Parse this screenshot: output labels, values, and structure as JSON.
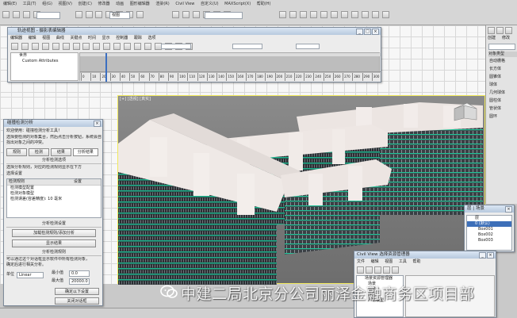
{
  "toolbar": {
    "view_dropdown": "视图",
    "selection_set_field": "",
    "main_menu": [
      "编辑(E)",
      "工具(T)",
      "组(G)",
      "视图(V)",
      "创建(C)",
      "修改器",
      "动画",
      "图形编辑器",
      "渲染(R)",
      "Civil View",
      "自定义(U)",
      "MAXScript(X)",
      "帮助(H)"
    ]
  },
  "track_view": {
    "title": "轨迹视图 - 摄影表编辑器",
    "menus": [
      "编辑器",
      "编辑",
      "视图",
      "曲线",
      "关键点",
      "时间",
      "显示",
      "控制器",
      "跟踪",
      "选项"
    ],
    "tree": [
      "世界",
      "Custom Attributes"
    ],
    "ruler_ticks": [
      "0",
      "10",
      "20",
      "30",
      "40",
      "50",
      "60",
      "70",
      "80",
      "90",
      "100",
      "110",
      "120",
      "130",
      "140",
      "150",
      "160",
      "170",
      "180",
      "190",
      "200",
      "210",
      "220",
      "230",
      "240",
      "250",
      "260",
      "270",
      "280",
      "290",
      "300"
    ]
  },
  "viewport": {
    "label": "[+] [透视] [真实]"
  },
  "left_dialog": {
    "title": "碰撞检测分析",
    "intro": "欢迎使用：碰撞检测分析工具！",
    "desc1": "选择要检测的对象集合，然后点击分析按钮，系统会自动",
    "desc2": "找出对象之间的冲突。",
    "tabs": [
      "规则",
      "检测",
      "结果",
      "分析结果"
    ],
    "section_title": "分析检测选项",
    "hint": "选择分析规则，对应的检测规则显示在下方",
    "sub": "选择设置",
    "col_name": "检测规则",
    "col_status": "设置",
    "rules": [
      "检测模型配置",
      "检测对象模型",
      "检测误差(容差精度): 10 毫米"
    ],
    "section2": "分析检测设置",
    "btn_add": "加载检测规则/添加分析",
    "btn_view": "显示结果",
    "section3": "分析检测规则",
    "detail1": "可以通过这个对话框显示软件中所有检测对象，",
    "detail2": "确定后进行相关分析。",
    "unit_label": "单位",
    "unit_value": "Linear",
    "min_label": "最小值",
    "min_value": "0.0",
    "max_label": "最大值",
    "max_value": "20000.0",
    "btn_ok": "确定以下设置",
    "btn_close": "关闭对话框"
  },
  "right_panel": {
    "tabs": [
      "创建",
      "修改"
    ],
    "section": "对象类型",
    "items": [
      "自动栅格",
      "长方体",
      "圆锥体",
      "球体",
      "几何球体",
      "圆柱体",
      "管状体",
      "圆环"
    ]
  },
  "scene_explorer": {
    "title": "层 | 场景",
    "items": [
      "层",
      "0 (默认)",
      "Box001",
      "Box002",
      "Box003"
    ]
  },
  "bottom_dialog": {
    "title": "Civil View 选择资源管理器",
    "menus": [
      "文件",
      "编辑",
      "视图",
      "工具",
      "帮助"
    ],
    "tree": [
      "场景资源管理器",
      "场景",
      "材质",
      "贴图",
      "人物模型"
    ]
  },
  "watermark": {
    "text": "中建二局北京分公司丽泽金融商务区项目部"
  }
}
